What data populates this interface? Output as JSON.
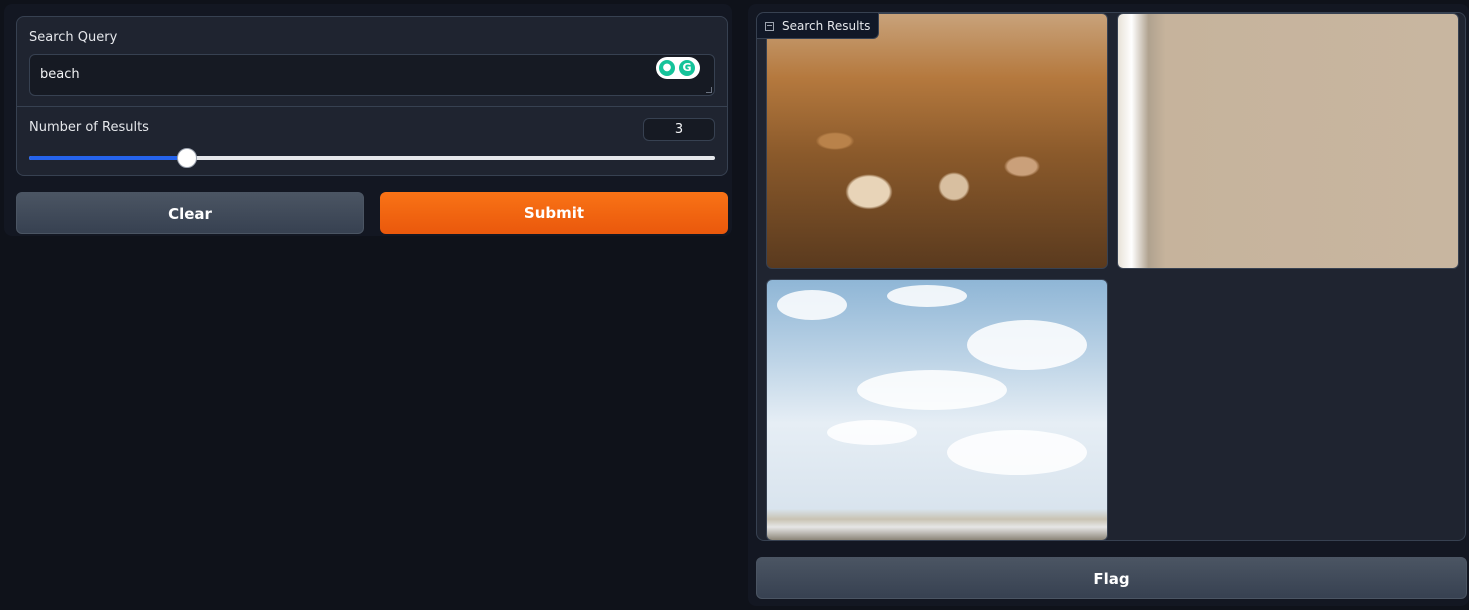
{
  "search": {
    "label": "Search Query",
    "value": "beach"
  },
  "results_count": {
    "label": "Number of Results",
    "value": "3",
    "slider_fraction": 0.23
  },
  "buttons": {
    "clear": "Clear",
    "submit": "Submit",
    "flag": "Flag"
  },
  "gallery": {
    "label": "Search Results",
    "images": [
      {
        "name": "beach-shells-image"
      },
      {
        "name": "beach-wave-sand-image"
      },
      {
        "name": "beach-sky-image"
      }
    ]
  },
  "colors": {
    "accent": "#f97316",
    "slider": "#2563eb",
    "background": "#0f121a"
  }
}
